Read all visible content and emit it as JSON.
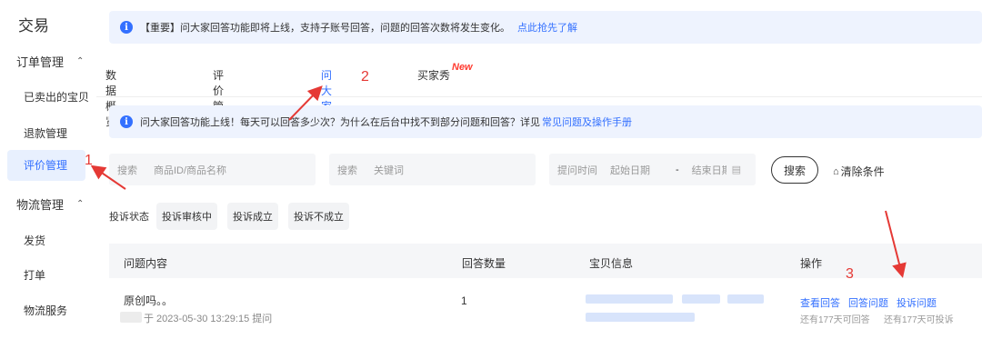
{
  "sidebar": {
    "title": "交易",
    "groups": [
      {
        "label": "订单管理",
        "items": [
          "已卖出的宝贝",
          "退款管理",
          "评价管理"
        ]
      },
      {
        "label": "物流管理",
        "items": [
          "发货",
          "打单",
          "物流服务"
        ]
      }
    ],
    "active_item": "评价管理"
  },
  "notice_top": {
    "text": "【重要】问大家回答功能即将上线，支持子账号回答，问题的回答次数将发生变化。",
    "link": "点此抢先了解"
  },
  "tabs": [
    "数据概览",
    "评价管理",
    "问大家",
    "买家秀"
  ],
  "active_tab": "问大家",
  "new_badge": "New",
  "notice_mid": {
    "text": "问大家回答功能上线！每天可以回答多少次？为什么在后台中找不到部分问题和回答？详见",
    "link": "常见问题及操作手册"
  },
  "filters": {
    "search1_label": "搜索",
    "search1_placeholder": "商品ID/商品名称",
    "search2_label": "搜索",
    "search2_placeholder": "关键词",
    "time_label": "提问时间",
    "start_placeholder": "起始日期",
    "sep": "-",
    "end_placeholder": "结束日期",
    "search_button": "搜索",
    "clear_button": "清除条件"
  },
  "complaint": {
    "label": "投诉状态",
    "options": [
      "投诉审核中",
      "投诉成立",
      "投诉不成立"
    ]
  },
  "table": {
    "headers": [
      "问题内容",
      "回答数量",
      "宝贝信息",
      "操作"
    ],
    "rows": [
      {
        "question": "原创吗。。",
        "asked_at": "于 2023-05-30 13:29:15 提问",
        "answer_count": "1",
        "actions": [
          "查看回答",
          "回答问题",
          "投诉问题"
        ],
        "answer_hint": "还有177天可回答",
        "complaint_hint": "还有177天可投诉"
      }
    ]
  },
  "annotations": [
    "1",
    "2",
    "3"
  ],
  "colors": {
    "accent": "#3370ff",
    "annotation": "#e53935",
    "notice_bg": "#eef3fe"
  }
}
